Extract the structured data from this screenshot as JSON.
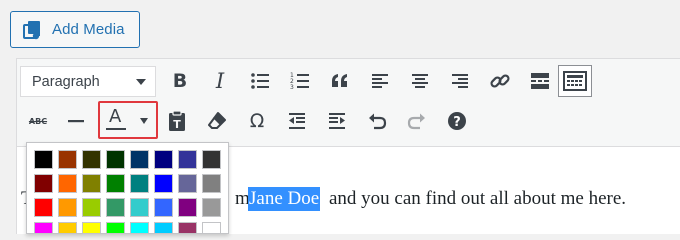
{
  "media": {
    "add_label": "Add Media"
  },
  "editor": {
    "format_select": "Paragraph",
    "row1": [
      "bold-icon",
      "italic-icon",
      "bulleted-list-icon",
      "numbered-list-icon",
      "blockquote-icon",
      "align-left-icon",
      "align-center-icon",
      "align-right-icon",
      "insert-link-icon",
      "read-more-icon",
      "toolbar-toggle-icon"
    ],
    "row2": [
      "strikethrough-icon",
      "horizontal-line-icon",
      "text-color-icon",
      "paste-as-text-icon",
      "clear-formatting-icon",
      "special-character-icon",
      "decrease-indent-icon",
      "increase-indent-icon",
      "undo-icon",
      "redo-icon",
      "help-icon"
    ],
    "bold_glyph": "B",
    "italic_glyph": "I",
    "omega_glyph": "Ω",
    "text_color_glyph": "A",
    "strike_glyph": "ABC",
    "help_glyph": "?"
  },
  "content": {
    "before": "m",
    "selected": "Jane Doe",
    "after": " and you can find out all about me here.",
    "leading_fragment": "T"
  },
  "color_palette": {
    "rows": [
      [
        "#000000",
        "#993300",
        "#333300",
        "#003300",
        "#003366",
        "#000080",
        "#333399",
        "#333333"
      ],
      [
        "#800000",
        "#ff6600",
        "#808000",
        "#008000",
        "#008080",
        "#0000ff",
        "#666699",
        "#808080"
      ],
      [
        "#ff0000",
        "#ff9900",
        "#99cc00",
        "#339966",
        "#33cccc",
        "#3366ff",
        "#800080",
        "#999999"
      ],
      [
        "#ff00ff",
        "#ffcc00",
        "#ffff00",
        "#00ff00",
        "#00ffff",
        "#00ccff",
        "#993366",
        "#ffffff"
      ]
    ]
  },
  "colors": {
    "accent": "#2271b1",
    "highlight_border": "#e0383d",
    "selection": "#3390ff",
    "icon": "#3c434a"
  }
}
